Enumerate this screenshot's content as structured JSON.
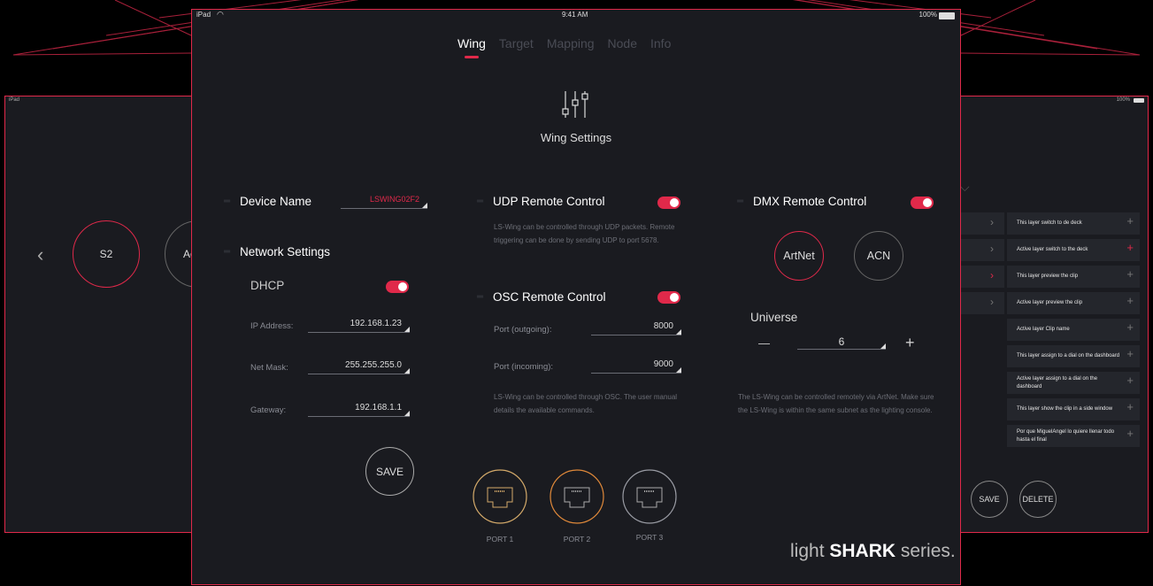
{
  "colors": {
    "accent": "#e0294a",
    "port1": "#d4aa6a",
    "port2": "#e0893a",
    "port3": "#9a9ca4"
  },
  "left_panel": {
    "status_left": "iPad",
    "circle_s2": "S2",
    "circle_partial": "Ac"
  },
  "right_panel": {
    "status_right": "100%",
    "items": [
      "This layer switch to de deck",
      "Active layer switch to the deck",
      "This layer preview the clip",
      "Active layer preview the clip",
      "Active layer Clip name",
      "This layer assign to a dial on the dashboard",
      "Active layer assign to a dial on the dashboard",
      "This layer show the clip in a side window",
      "Por que MiguelAngel lo quiere llenar todo hasta el final"
    ],
    "plus": "+",
    "chevron": "›",
    "save": "SAVE",
    "delete": "DELETE"
  },
  "status": {
    "device": "iPad",
    "time": "9:41 AM",
    "battery": "100%"
  },
  "tabs": [
    "Wing",
    "Target",
    "Mapping",
    "Node",
    "Info"
  ],
  "header_title": "Wing Settings",
  "device": {
    "label": "Device Name",
    "value": "LSWING02F2"
  },
  "network": {
    "heading": "Network Settings",
    "dhcp": "DHCP",
    "ip_label": "IP Address:",
    "ip_value": "192.168.1.23",
    "mask_label": "Net Mask:",
    "mask_value": "255.255.255.0",
    "gw_label": "Gateway:",
    "gw_value": "192.168.1.1",
    "save": "SAVE"
  },
  "udp": {
    "heading": "UDP Remote Control",
    "desc": "LS-Wing can be controlled through UDP packets. Remote triggering can be done by sending UDP  to port 5678."
  },
  "osc": {
    "heading": "OSC Remote Control",
    "out_label": "Port (outgoing):",
    "out_value": "8000",
    "in_label": "Port (incoming):",
    "in_value": "9000",
    "desc": "LS-Wing can be controlled through OSC. The user manual details the available commands."
  },
  "dmx": {
    "heading": "DMX Remote Control",
    "artnet": "ArtNet",
    "acn": "ACN",
    "universe_label": "Universe",
    "universe_value": "6",
    "minus": "—",
    "plus": "+",
    "desc": "The LS-Wing can be controlled remotely via ArtNet. Make sure the LS-Wing is within the same subnet as the lighting console."
  },
  "ports": [
    "PORT 1",
    "PORT 2",
    "PORT 3"
  ],
  "brand": {
    "light": "light ",
    "shark": "SHARK",
    "series": " series."
  }
}
